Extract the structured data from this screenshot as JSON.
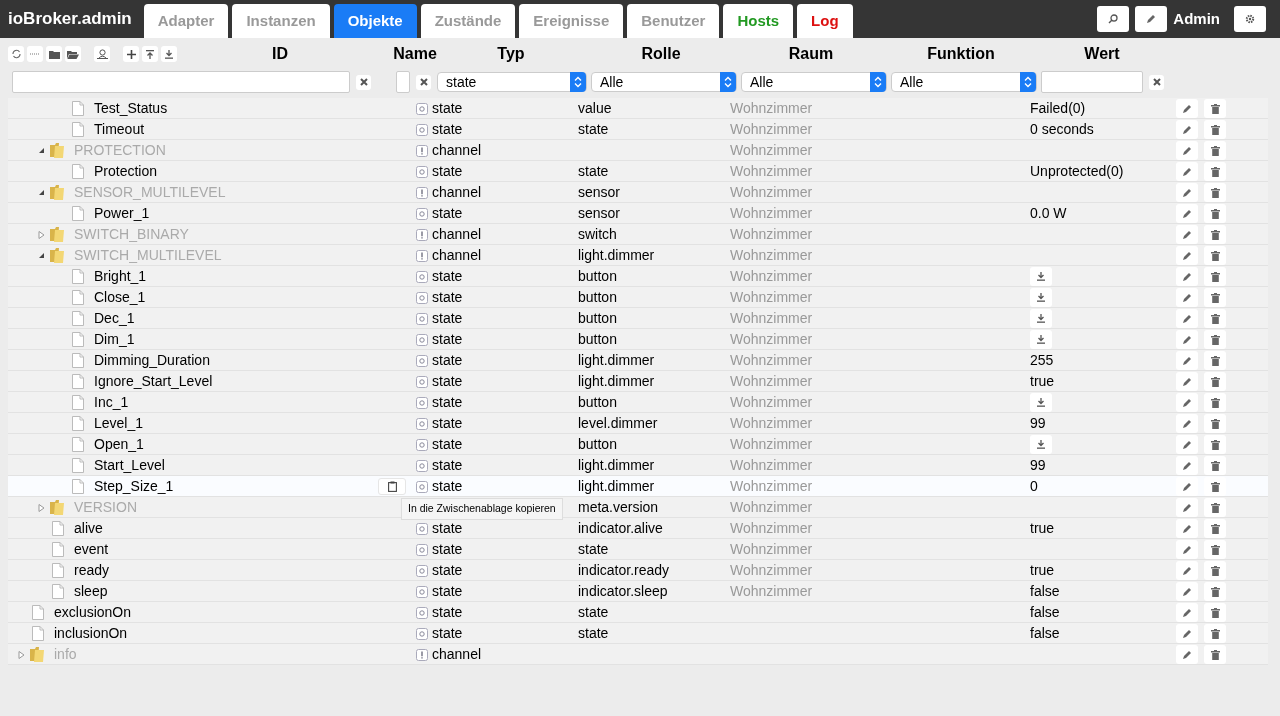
{
  "brand": "ioBroker.admin",
  "tabs": [
    {
      "label": "Adapter",
      "selected": false,
      "color": "#999999"
    },
    {
      "label": "Instanzen",
      "selected": false,
      "color": "#999999"
    },
    {
      "label": "Objekte",
      "selected": true
    },
    {
      "label": "Zustände",
      "selected": false,
      "color": "#999999"
    },
    {
      "label": "Ereignisse",
      "selected": false,
      "color": "#999999"
    },
    {
      "label": "Benutzer",
      "selected": false,
      "color": "#999999"
    },
    {
      "label": "Hosts",
      "selected": false,
      "color": "#229922"
    },
    {
      "label": "Log",
      "selected": false,
      "color": "#dd1111"
    }
  ],
  "user": "Admin",
  "columns": [
    "ID",
    "Name",
    "Typ",
    "Rolle",
    "Raum",
    "Funktion",
    "Wert"
  ],
  "filters": {
    "type": "state",
    "role": "Alle",
    "room": "Alle",
    "function": "Alle"
  },
  "tree": [
    {
      "children": [
        {
          "children": [
            {
              "id": "Test_Status",
              "kind": "file",
              "type": "state",
              "role": "value",
              "room": "Wohnzimmer",
              "value": "Failed(0)",
              "highlighted": false
            },
            {
              "id": "Timeout",
              "kind": "file",
              "type": "state",
              "role": "state",
              "room": "Wohnzimmer",
              "value": "0 seconds",
              "highlighted": false
            }
          ]
        },
        {
          "id": "PROTECTION",
          "kind": "folder",
          "expanded": true,
          "type": "channel",
          "room": "Wohnzimmer",
          "highlighted": false,
          "children": [
            {
              "id": "Protection",
              "kind": "file",
              "type": "state",
              "role": "state",
              "room": "Wohnzimmer",
              "value": "Unprotected(0)",
              "highlighted": false
            }
          ]
        },
        {
          "id": "SENSOR_MULTILEVEL",
          "kind": "folder",
          "expanded": true,
          "type": "channel",
          "role": "sensor",
          "room": "Wohnzimmer",
          "highlighted": false,
          "children": [
            {
              "id": "Power_1",
              "kind": "file",
              "type": "state",
              "role": "sensor",
              "room": "Wohnzimmer",
              "value": "0.0 W",
              "highlighted": false
            }
          ]
        },
        {
          "id": "SWITCH_BINARY",
          "kind": "folder",
          "expanded": false,
          "type": "channel",
          "role": "switch",
          "room": "Wohnzimmer",
          "highlighted": false
        },
        {
          "id": "SWITCH_MULTILEVEL",
          "kind": "folder",
          "expanded": true,
          "type": "channel",
          "role": "light.dimmer",
          "room": "Wohnzimmer",
          "highlighted": false,
          "children": [
            {
              "id": "Bright_1",
              "kind": "file",
              "type": "state",
              "role": "button",
              "room": "Wohnzimmer",
              "value_button": true,
              "highlighted": false
            },
            {
              "id": "Close_1",
              "kind": "file",
              "type": "state",
              "role": "button",
              "room": "Wohnzimmer",
              "value_button": true,
              "highlighted": false
            },
            {
              "id": "Dec_1",
              "kind": "file",
              "type": "state",
              "role": "button",
              "room": "Wohnzimmer",
              "value_button": true,
              "highlighted": false
            },
            {
              "id": "Dim_1",
              "kind": "file",
              "type": "state",
              "role": "button",
              "room": "Wohnzimmer",
              "value_button": true,
              "highlighted": false
            },
            {
              "id": "Dimming_Duration",
              "kind": "file",
              "type": "state",
              "role": "light.dimmer",
              "room": "Wohnzimmer",
              "value": "255",
              "highlighted": false
            },
            {
              "id": "Ignore_Start_Level",
              "kind": "file",
              "type": "state",
              "role": "light.dimmer",
              "room": "Wohnzimmer",
              "value": "true",
              "highlighted": false
            },
            {
              "id": "Inc_1",
              "kind": "file",
              "type": "state",
              "role": "button",
              "room": "Wohnzimmer",
              "value_button": true,
              "highlighted": false
            },
            {
              "id": "Level_1",
              "kind": "file",
              "type": "state",
              "role": "level.dimmer",
              "room": "Wohnzimmer",
              "value": "99",
              "highlighted": false
            },
            {
              "id": "Open_1",
              "kind": "file",
              "type": "state",
              "role": "button",
              "room": "Wohnzimmer",
              "value_button": true,
              "highlighted": false
            },
            {
              "id": "Start_Level",
              "kind": "file",
              "type": "state",
              "role": "light.dimmer",
              "room": "Wohnzimmer",
              "value": "99",
              "highlighted": false
            },
            {
              "id": "Step_Size_1",
              "kind": "file",
              "type": "state",
              "role": "light.dimmer",
              "room": "Wohnzimmer",
              "value": "0",
              "highlighted": true
            }
          ]
        },
        {
          "id": "VERSION",
          "kind": "folder",
          "expanded": false,
          "role": "meta.version",
          "room": "Wohnzimmer",
          "highlighted": false
        },
        {
          "id": "alive",
          "kind": "file",
          "type": "state",
          "role": "indicator.alive",
          "room": "Wohnzimmer",
          "value": "true",
          "highlighted": false
        },
        {
          "id": "event",
          "kind": "file",
          "type": "state",
          "role": "state",
          "room": "Wohnzimmer",
          "highlighted": false
        },
        {
          "id": "ready",
          "kind": "file",
          "type": "state",
          "role": "indicator.ready",
          "room": "Wohnzimmer",
          "value": "true",
          "highlighted": false
        },
        {
          "id": "sleep",
          "kind": "file",
          "type": "state",
          "role": "indicator.sleep",
          "room": "Wohnzimmer",
          "value": "false",
          "highlighted": false
        }
      ]
    },
    {
      "id": "exclusionOn",
      "kind": "file",
      "type": "state",
      "role": "state",
      "value": "false",
      "highlighted": false
    },
    {
      "id": "inclusionOn",
      "kind": "file",
      "type": "state",
      "role": "state",
      "value": "false",
      "highlighted": false
    },
    {
      "id": "info",
      "kind": "folder",
      "expanded": false,
      "type": "channel",
      "highlighted": false
    }
  ],
  "tooltip": "In die Zwischenablage kopieren"
}
